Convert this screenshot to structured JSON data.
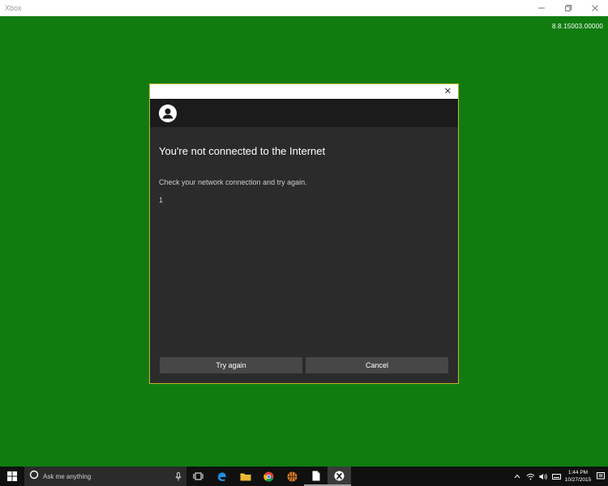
{
  "window": {
    "title": "Xbox",
    "minimize_icon": "minimize-icon",
    "restore_icon": "restore-icon",
    "close_icon": "close-icon"
  },
  "app": {
    "version": "8.8.15003.00000",
    "background_color": "#107c10"
  },
  "dialog": {
    "close_label": "✕",
    "title": "You're not connected to the Internet",
    "message": "Check your network connection and try again.",
    "code": "1",
    "buttons": {
      "try_again": "Try again",
      "cancel": "Cancel"
    },
    "accent_color": "#c6b51d"
  },
  "taskbar": {
    "search_placeholder": "Ask me anything",
    "apps": [
      "task-view-icon",
      "edge-icon",
      "file-explorer-icon",
      "chrome-icon",
      "basketball-app-icon",
      "document-icon",
      "xbox-icon"
    ],
    "active_app": "xbox-icon",
    "clock": {
      "time": "1:44 PM",
      "date": "10/27/2015"
    }
  }
}
